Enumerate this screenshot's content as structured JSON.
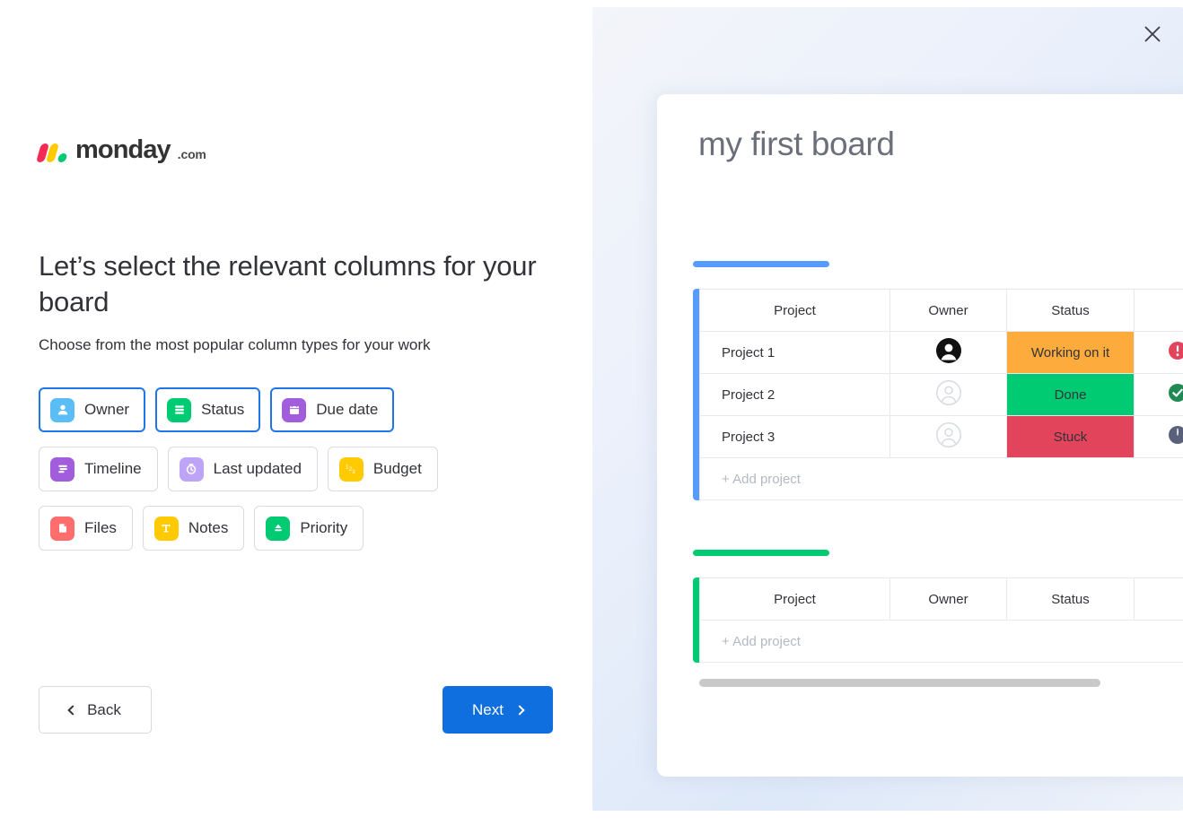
{
  "brand": {
    "name": "monday",
    "tld": ".com",
    "colors": {
      "red": "#f62b54",
      "yellow": "#ffcb00",
      "green": "#00ca72",
      "accent": "#0f6fde"
    }
  },
  "left": {
    "headline": "Let’s select the relevant columns for your board",
    "subhead": "Choose from the most popular column types for your work",
    "columns": [
      {
        "label": "Owner",
        "icon": "person-icon",
        "color": "#5bbdf5",
        "selected": true
      },
      {
        "label": "Status",
        "icon": "status-bars-icon",
        "color": "#00ca72",
        "selected": true
      },
      {
        "label": "Due date",
        "icon": "calendar-icon",
        "color": "#a25ddc",
        "selected": true
      },
      {
        "label": "Timeline",
        "icon": "timeline-icon",
        "color": "#a25ddc",
        "selected": false
      },
      {
        "label": "Last updated",
        "icon": "clock-icon",
        "color": "#bda4f7",
        "selected": false
      },
      {
        "label": "Budget",
        "icon": "numbers-123-icon",
        "color": "#ffcb00",
        "selected": false
      },
      {
        "label": "Files",
        "icon": "file-icon",
        "color": "#ff6d6d",
        "selected": false
      },
      {
        "label": "Notes",
        "icon": "text-t-icon",
        "color": "#ffcb00",
        "selected": false
      },
      {
        "label": "Priority",
        "icon": "priority-icon",
        "color": "#00ca72",
        "selected": false
      }
    ],
    "back_label": "Back",
    "next_label": "Next"
  },
  "preview": {
    "close_label": "Close",
    "board_title": "my first board",
    "columns": [
      "Project",
      "Owner",
      "Status",
      ""
    ],
    "add_project_label": "+ Add project",
    "groups": [
      {
        "color": "#579bfc",
        "rows": [
          {
            "project": "Project 1",
            "owner": "filled-avatar",
            "status": "Working on it",
            "status_color": "#fdab3d",
            "indicator": "alert-icon",
            "indicator_color": "#e2445c"
          },
          {
            "project": "Project 2",
            "owner": "empty-avatar",
            "status": "Done",
            "status_color": "#00ca72",
            "indicator": "check-icon",
            "indicator_color": "#1f8a54"
          },
          {
            "project": "Project 3",
            "owner": "empty-avatar",
            "status": "Stuck",
            "status_color": "#e2445c",
            "indicator": "clock-icon",
            "indicator_color": "#59607a"
          }
        ]
      },
      {
        "color": "#00ca72",
        "rows": []
      }
    ],
    "scroll_position_percent": 78
  }
}
